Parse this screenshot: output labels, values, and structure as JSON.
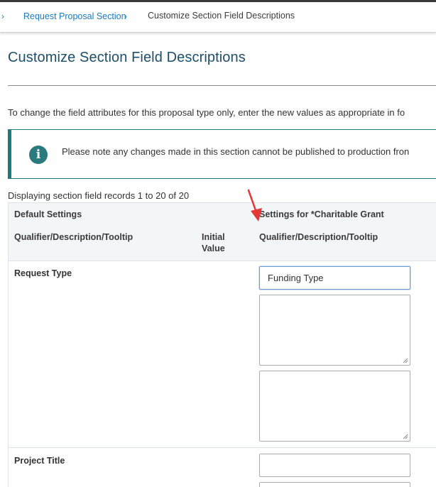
{
  "breadcrumb": {
    "separator": "›",
    "link": "Request Proposal Section",
    "current": "Customize Section Field Descriptions"
  },
  "page": {
    "title": "Customize Section Field Descriptions",
    "intro": "To change the field attributes for this proposal type only, enter the new values as appropriate in fo",
    "alert": "Please note any changes made in this section cannot be published to production fron",
    "records": "Displaying section field records 1 to 20 of 20"
  },
  "table": {
    "group_default": "Default Settings",
    "group_custom": "Settings for *Charitable Grant",
    "col_qualifier": "Qualifier/Description/Tooltip",
    "col_initial_line1": "Initial",
    "col_initial_line2": "Value",
    "col_custom_qualifier": "Qualifier/Description/Tooltip",
    "rows": [
      {
        "label": "Request Type",
        "qualifier_value": "Funding Type",
        "description": "",
        "tooltip": ""
      },
      {
        "label": "Project Title",
        "qualifier_value": ""
      }
    ]
  },
  "colors": {
    "accent": "#1a7bbf",
    "alert_border": "#1f7a80",
    "title": "#1d4f6b",
    "annotation_arrow": "#e53935"
  },
  "icons": {
    "alert": "info-icon",
    "annotation": "red-arrow-annotation"
  }
}
